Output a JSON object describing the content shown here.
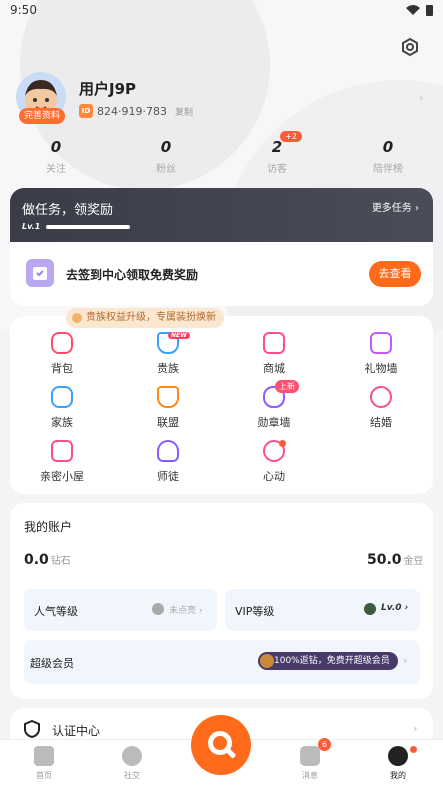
{
  "status_bar": {
    "time": "9:50"
  },
  "profile": {
    "complete_badge": "完善资料",
    "username": "用户J9P",
    "id_tag": "ID",
    "user_id": "824·919·783",
    "copy_label": "复制"
  },
  "stats": [
    {
      "value": "0",
      "label": "关注"
    },
    {
      "value": "0",
      "label": "粉丝"
    },
    {
      "value": "2",
      "label": "访客",
      "badge": "+2"
    },
    {
      "value": "0",
      "label": "陪伴榜"
    }
  ],
  "task": {
    "title": "做任务，领奖励",
    "more": "更多任务 ›",
    "level": "Lv.1",
    "checkin_text": "去签到中心领取免费奖励",
    "button": "去查看"
  },
  "menu": {
    "tip": "贵族权益升级，专属装扮焕新",
    "new_tag": "NEW",
    "new_badge": "上新",
    "items": [
      "背包",
      "贵族",
      "商城",
      "礼物墙",
      "家族",
      "联盟",
      "勋章墙",
      "结婚",
      "亲密小屋",
      "师徒",
      "心动"
    ]
  },
  "account": {
    "title": "我的账户",
    "diamond_value": "0.0",
    "diamond_unit": "钻石",
    "gold_value": "50.0",
    "gold_unit": "金豆",
    "popularity_label": "人气等级",
    "popularity_status": "未点亮 ›",
    "vip_label": "VIP等级",
    "vip_level": "Lv.0 ›",
    "super_member_label": "超级会员",
    "super_member_promo": "100%返钻，免费开超级会员"
  },
  "auth": {
    "label": "认证中心"
  },
  "tabs": [
    {
      "label": "首页"
    },
    {
      "label": "社交"
    },
    {
      "label": "消息",
      "badge": "6"
    },
    {
      "label": "我的"
    }
  ],
  "colors": {
    "accent": "#ff6b1a",
    "dark_header": "#3a3c47",
    "badge_red": "#ff5b3a"
  }
}
